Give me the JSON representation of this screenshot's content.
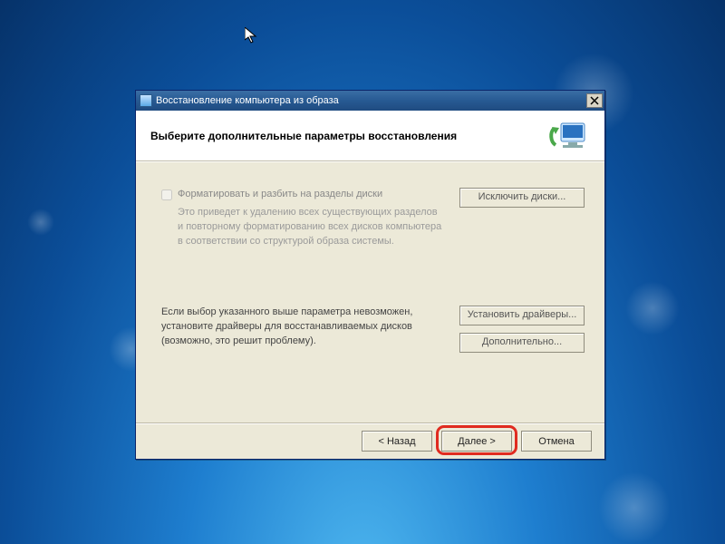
{
  "window_title": "Восстановление компьютера из образа",
  "header": "Выберите дополнительные параметры восстановления",
  "section1": {
    "checkbox_label": "Форматировать и разбить на разделы диски",
    "desc": "Это приведет к удалению всех существующих разделов и повторному форматированию всех дисков компьютера в соответствии со структурой образа системы.",
    "exclude_btn": "Исключить диски..."
  },
  "section2": {
    "desc": "Если выбор указанного выше параметра невозможен, установите драйверы для восстанавливаемых дисков (возможно, это решит проблему).",
    "drivers_btn": "Установить драйверы...",
    "advanced_btn": "Дополнительно..."
  },
  "footer": {
    "back": "< Назад",
    "next": "Далее >",
    "cancel": "Отмена"
  }
}
